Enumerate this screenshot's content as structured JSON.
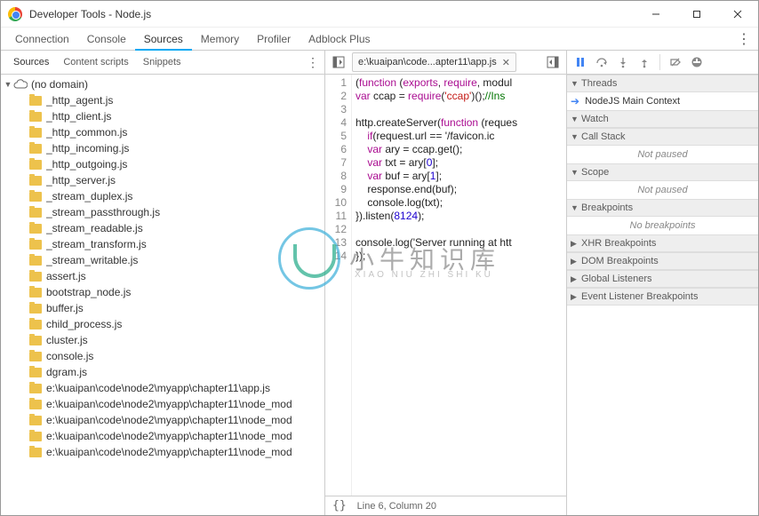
{
  "window": {
    "title": "Developer Tools - Node.js"
  },
  "tabs": [
    "Connection",
    "Console",
    "Sources",
    "Memory",
    "Profiler",
    "Adblock Plus"
  ],
  "activeTab": "Sources",
  "sourceSubtabs": [
    "Sources",
    "Content scripts",
    "Snippets"
  ],
  "activeSubtab": "Sources",
  "tree": {
    "root": "(no domain)",
    "items": [
      "_http_agent.js",
      "_http_client.js",
      "_http_common.js",
      "_http_incoming.js",
      "_http_outgoing.js",
      "_http_server.js",
      "_stream_duplex.js",
      "_stream_passthrough.js",
      "_stream_readable.js",
      "_stream_transform.js",
      "_stream_writable.js",
      "assert.js",
      "bootstrap_node.js",
      "buffer.js",
      "child_process.js",
      "cluster.js",
      "console.js",
      "dgram.js",
      "e:\\kuaipan\\code\\node2\\myapp\\chapter11\\app.js",
      "e:\\kuaipan\\code\\node2\\myapp\\chapter11\\node_mod",
      "e:\\kuaipan\\code\\node2\\myapp\\chapter11\\node_mod",
      "e:\\kuaipan\\code\\node2\\myapp\\chapter11\\node_mod",
      "e:\\kuaipan\\code\\node2\\myapp\\chapter11\\node_mod"
    ]
  },
  "openFile": {
    "tabLabel": "e:\\kuaipan\\code...apter11\\app.js"
  },
  "code": {
    "lines": [
      {
        "n": 1,
        "raw": "(function (exports, require, modul"
      },
      {
        "n": 2,
        "raw": "var ccap = require('ccap')();//Ins"
      },
      {
        "n": 3,
        "raw": ""
      },
      {
        "n": 4,
        "raw": "http.createServer(function (reques"
      },
      {
        "n": 5,
        "raw": "    if(request.url == '/favicon.ic"
      },
      {
        "n": 6,
        "raw": "    var ary = ccap.get();"
      },
      {
        "n": 7,
        "raw": "    var txt = ary[0];"
      },
      {
        "n": 8,
        "raw": "    var buf = ary[1];"
      },
      {
        "n": 9,
        "raw": "    response.end(buf);"
      },
      {
        "n": 10,
        "raw": "    console.log(txt);"
      },
      {
        "n": 11,
        "raw": "}).listen(8124);"
      },
      {
        "n": 12,
        "raw": ""
      },
      {
        "n": 13,
        "raw": "console.log('Server running at htt"
      },
      {
        "n": 14,
        "raw": "});"
      }
    ]
  },
  "statusbar": {
    "cursor": "Line 6, Column 20"
  },
  "rightPane": {
    "threads": {
      "title": "Threads",
      "item": "NodeJS Main Context"
    },
    "watch": {
      "title": "Watch"
    },
    "callstack": {
      "title": "Call Stack",
      "body": "Not paused"
    },
    "scope": {
      "title": "Scope",
      "body": "Not paused"
    },
    "breakpoints": {
      "title": "Breakpoints",
      "body": "No breakpoints"
    },
    "xhr": {
      "title": "XHR Breakpoints"
    },
    "dom": {
      "title": "DOM Breakpoints"
    },
    "global": {
      "title": "Global Listeners"
    },
    "event": {
      "title": "Event Listener Breakpoints"
    }
  },
  "watermark": {
    "big": "小牛知识库",
    "small": "XIAO NIU ZHI SHI KU"
  }
}
